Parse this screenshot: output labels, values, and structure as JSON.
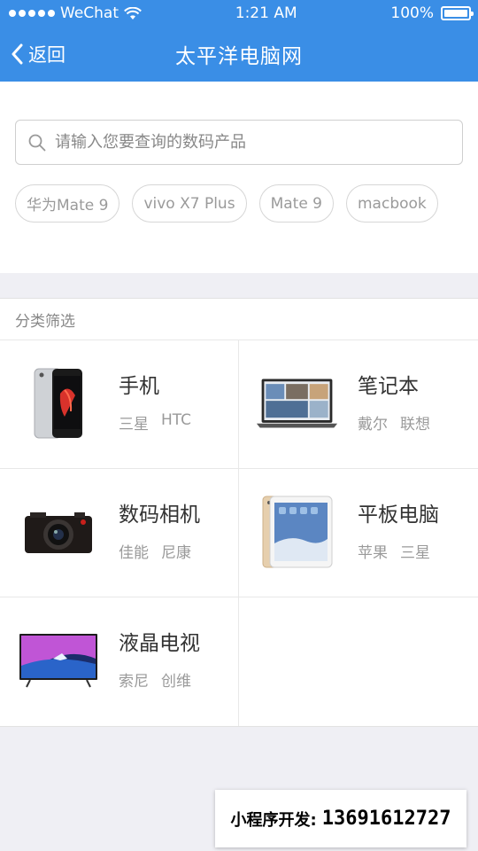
{
  "status_bar": {
    "carrier": "WeChat",
    "time": "1:21 AM",
    "battery": "100%"
  },
  "nav": {
    "back_label": "返回",
    "title": "太平洋电脑网"
  },
  "search": {
    "placeholder": "请输入您要查询的数码产品",
    "tags": [
      "华为Mate 9",
      "vivo X7 Plus",
      "Mate 9",
      "macbook"
    ]
  },
  "category": {
    "header": "分类筛选",
    "items": [
      {
        "name": "手机",
        "brands": [
          "三星",
          "HTC"
        ],
        "icon": "phone-image"
      },
      {
        "name": "笔记本",
        "brands": [
          "戴尔",
          "联想"
        ],
        "icon": "laptop-image"
      },
      {
        "name": "数码相机",
        "brands": [
          "佳能",
          "尼康"
        ],
        "icon": "camera-image"
      },
      {
        "name": "平板电脑",
        "brands": [
          "苹果",
          "三星"
        ],
        "icon": "tablet-image"
      },
      {
        "name": "液晶电视",
        "brands": [
          "索尼",
          "创维"
        ],
        "icon": "tv-image"
      }
    ]
  },
  "contact": {
    "label": "小程序开发:",
    "phone": "13691612727"
  },
  "colors": {
    "accent": "#3a8ee6",
    "background": "#efeff4"
  }
}
